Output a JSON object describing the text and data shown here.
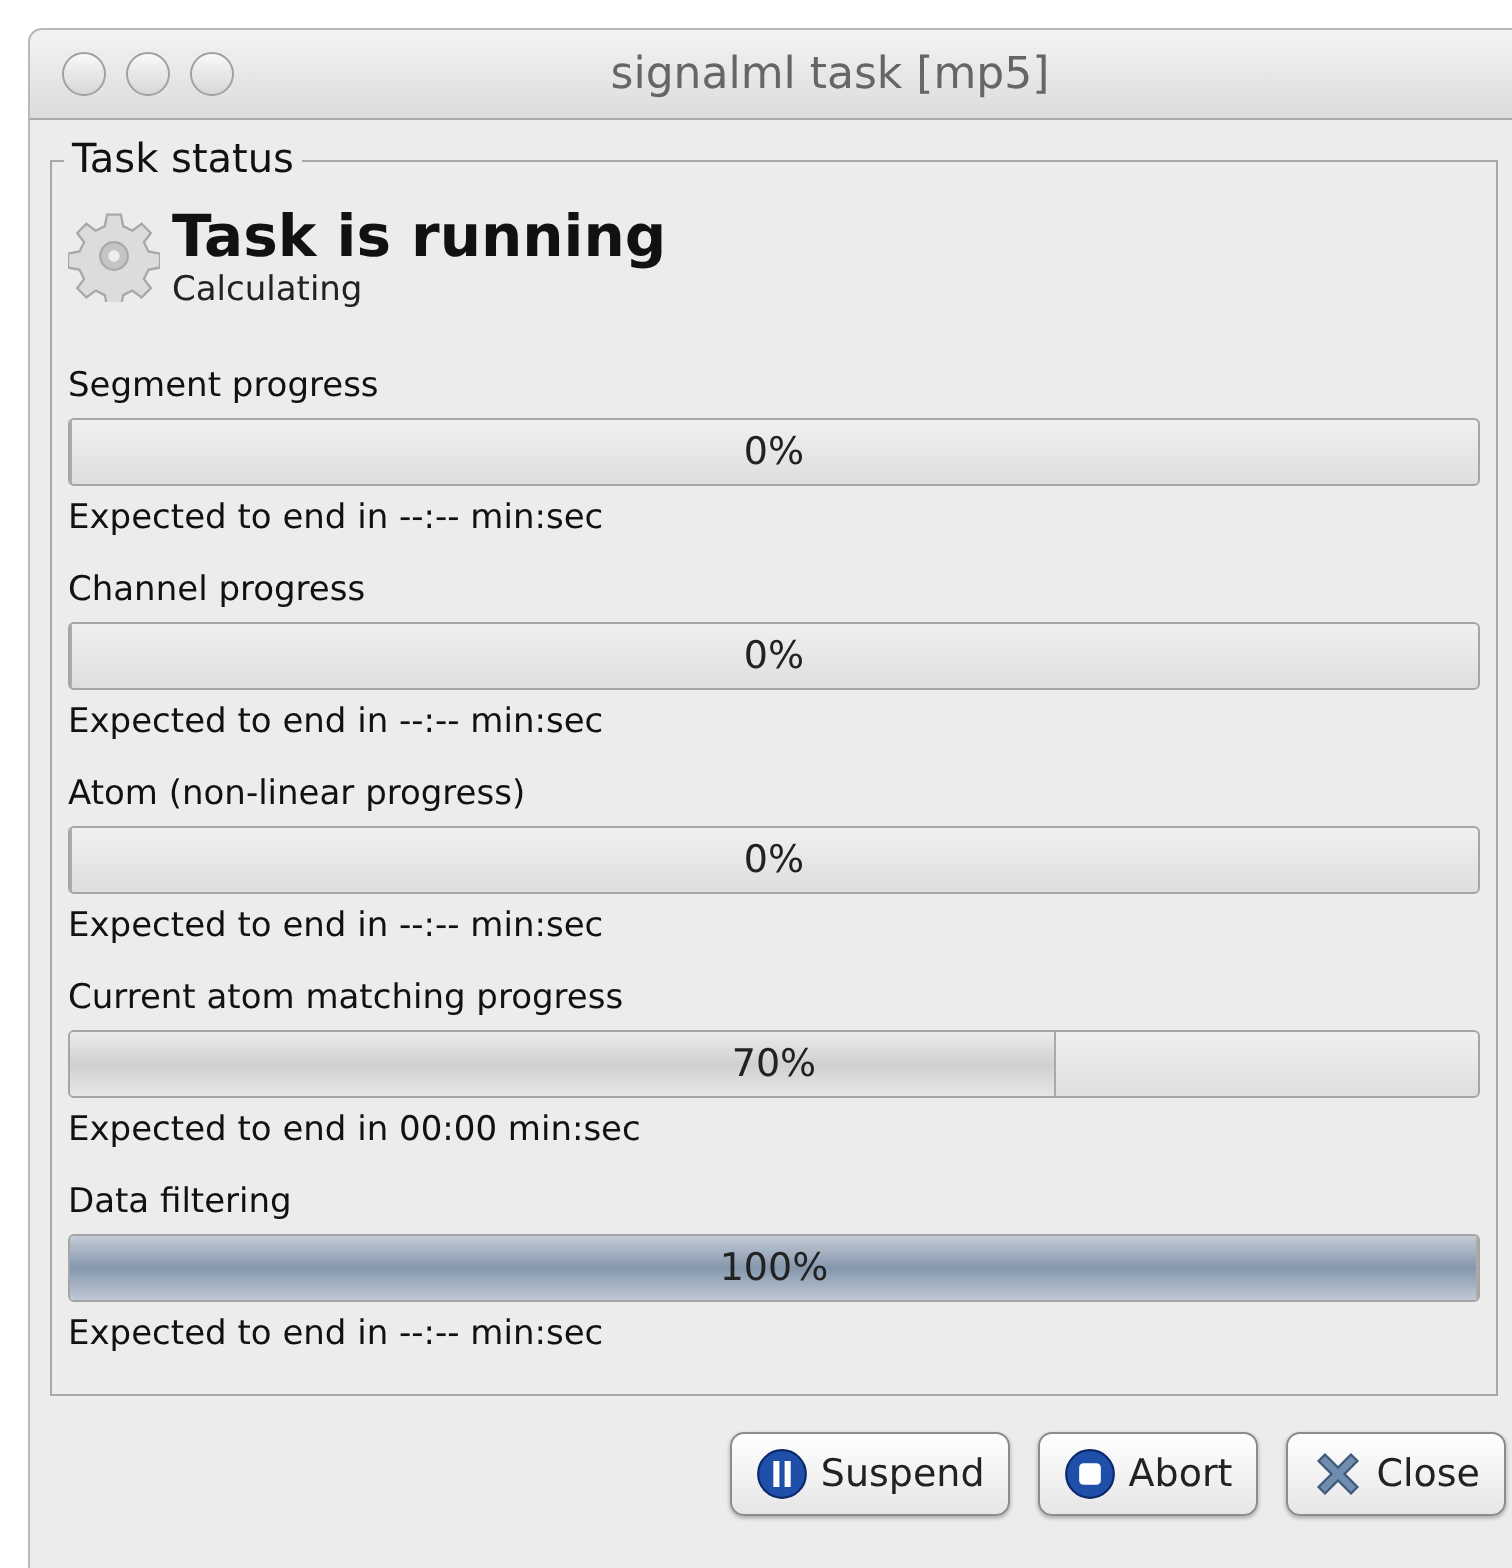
{
  "window": {
    "title": "signalml task [mp5]"
  },
  "task_status": {
    "legend": "Task status",
    "heading": "Task is running",
    "subheading": "Calculating"
  },
  "progress": [
    {
      "label": "Segment progress",
      "level": 0,
      "reading": "0%",
      "expected": "Expected to end in --:-- min:sec"
    },
    {
      "label": "Channel progress",
      "level": 0,
      "reading": "0%",
      "expected": "Expected to end in --:-- min:sec"
    },
    {
      "label": "Atom (non-linear progress)",
      "level": 0,
      "reading": "0%",
      "expected": "Expected to end in --:-- min:sec"
    },
    {
      "label": "Current atom matching progress",
      "level": 0.7,
      "reading": "70%",
      "expected": "Expected to end in 00:00 min:sec"
    },
    {
      "label": "Data filtering",
      "level": 1,
      "reading": "100%",
      "expected": "Expected to end in --:-- min:sec"
    }
  ],
  "buttons": [
    {
      "label": "Suspend",
      "kind": "pause"
    },
    {
      "label": "Abort",
      "kind": "stop"
    },
    {
      "label": "Close",
      "kind": "close"
    }
  ]
}
